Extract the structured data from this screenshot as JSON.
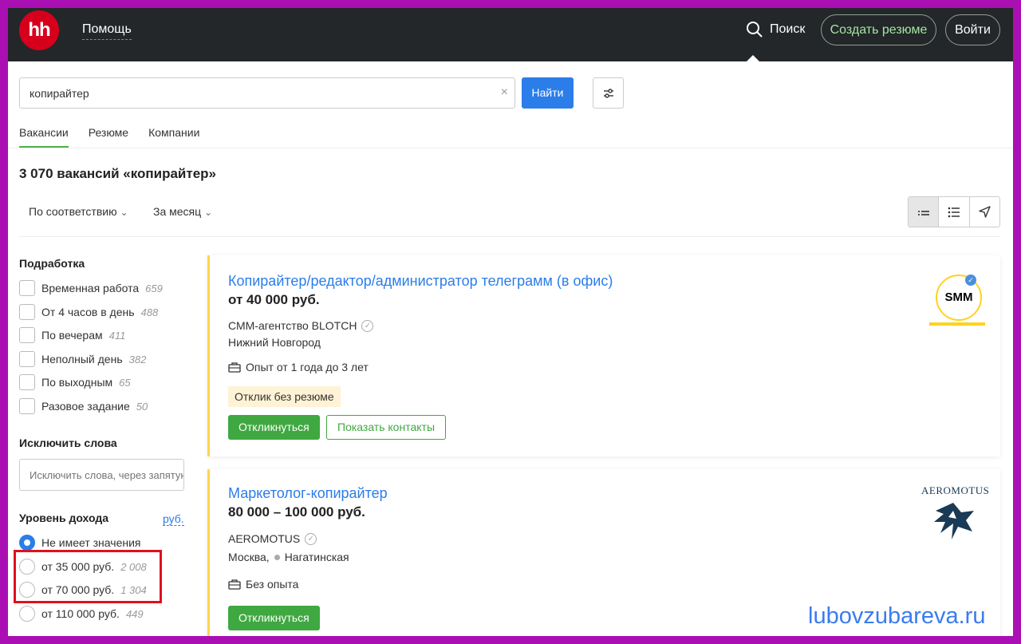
{
  "header": {
    "logo_text": "hh",
    "help_label": "Помощь",
    "search_label": "Поиск",
    "create_resume_label": "Создать резюме",
    "login_label": "Войти"
  },
  "search": {
    "query": "копирайтер",
    "clear_glyph": "×",
    "find_label": "Найти"
  },
  "tabs": [
    "Вакансии",
    "Резюме",
    "Компании"
  ],
  "results": {
    "title": "3 070 вакансий «копирайтер»",
    "sort_label": "По соответствию",
    "period_label": "За месяц"
  },
  "sidebar": {
    "work_heading": "Подработка",
    "work_options": [
      {
        "label": "Временная работа",
        "count": "659"
      },
      {
        "label": "От 4 часов в день",
        "count": "488"
      },
      {
        "label": "По вечерам",
        "count": "411"
      },
      {
        "label": "Неполный день",
        "count": "382"
      },
      {
        "label": "По выходным",
        "count": "65"
      },
      {
        "label": "Разовое задание",
        "count": "50"
      }
    ],
    "exclude_heading": "Исключить слова",
    "exclude_placeholder": "Исключить слова, через запятую",
    "income_heading": "Уровень дохода",
    "currency_label": "руб.",
    "income_options": [
      {
        "label": "Не имеет значения",
        "count": ""
      },
      {
        "label": "от 35 000 руб.",
        "count": "2 008"
      },
      {
        "label": "от 70 000 руб.",
        "count": "1 304"
      },
      {
        "label": "от 110 000 руб.",
        "count": "449"
      }
    ]
  },
  "vacancies": [
    {
      "title": "Копирайтер/редактор/администратор телеграмм (в офис)",
      "salary": "от 40 000 руб.",
      "company": "СММ-агентство BLOTCH",
      "city": "Нижний Новгород",
      "experience": "Опыт от 1 года до 3 лет",
      "tag": "Отклик без резюме",
      "apply_label": "Откликнуться",
      "contacts_label": "Показать контакты",
      "logo_text": "SMM"
    },
    {
      "title": "Маркетолог-копирайтер",
      "salary": "80 000 – 100 000 руб.",
      "company": "AEROMOTUS",
      "city": "Москва,",
      "metro": "Нагатинская",
      "experience": "Без опыта",
      "apply_label": "Откликнуться",
      "logo_text": "AEROMOTUS"
    }
  ],
  "watermark": "lubovzubareva.ru",
  "colors": {
    "header_bg": "#232729",
    "brand_red": "#d6001c",
    "primary_blue": "#2b7de9",
    "apply_green": "#40a840",
    "highlight_red": "#e0101e",
    "frame_purple": "#a90fb3"
  }
}
